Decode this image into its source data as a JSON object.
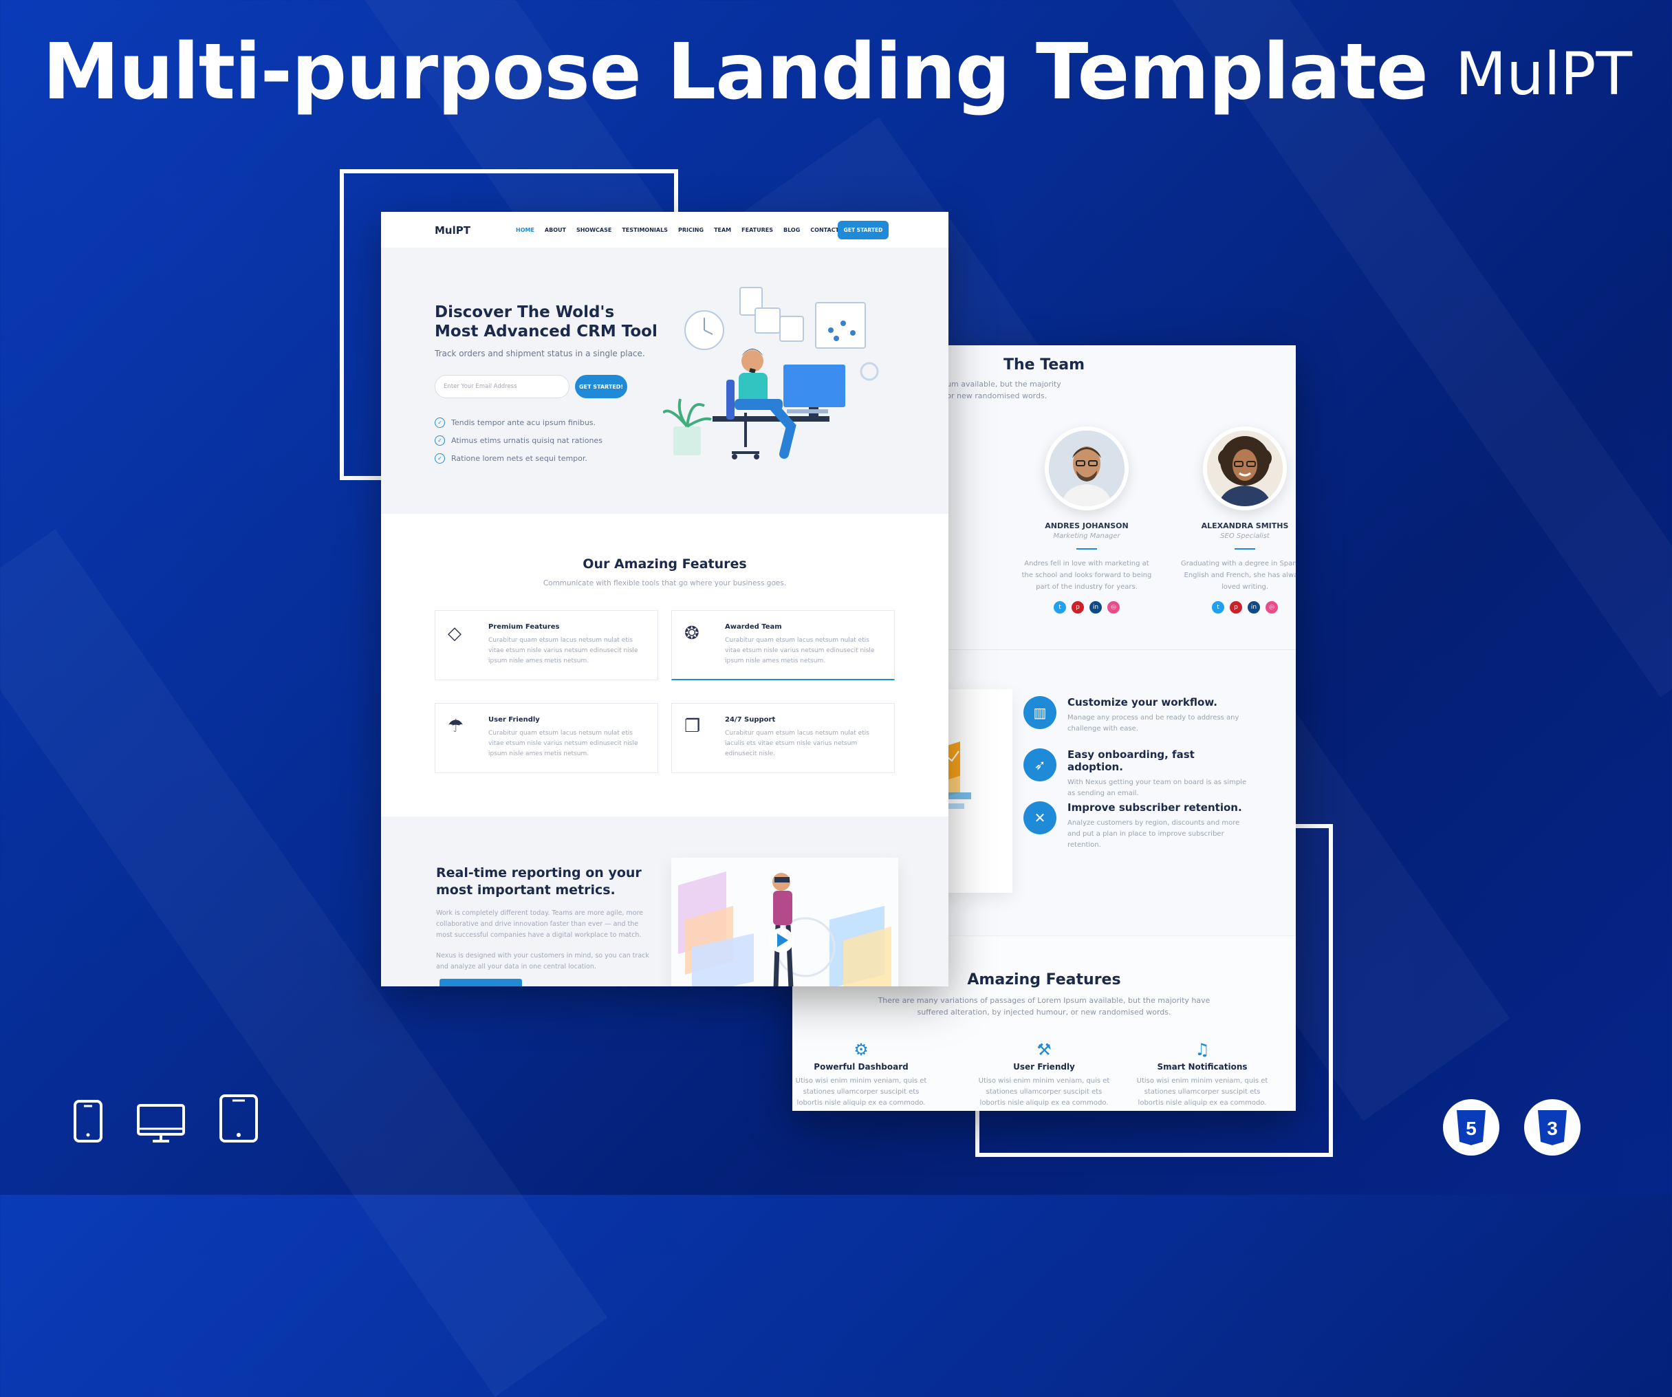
{
  "page": {
    "headline": "Multi-purpose Landing Template",
    "brand": "MulPT"
  },
  "front": {
    "nav": {
      "logo": "MulPT",
      "links": [
        "HOME",
        "ABOUT",
        "SHOWCASE",
        "TESTIMONIALS",
        "PRICING",
        "TEAM",
        "FEATURES",
        "BLOG",
        "CONTACT"
      ],
      "cta": "GET STARTED"
    },
    "hero": {
      "title": "Discover The Wold's Most Advanced CRM Tool",
      "subtitle": "Track orders and shipment status in a single place.",
      "email_placeholder": "Enter Your Email Address",
      "button": "GET STARTED!",
      "checks": [
        "Tendis tempor ante acu ipsum finibus.",
        "Atimus etims urnatis quisiq nat rationes",
        "Ratione lorem nets et sequi tempor."
      ]
    },
    "features": {
      "title": "Our Amazing Features",
      "subtitle": "Communicate with flexible tools that go where your business goes.",
      "cards": [
        {
          "title": "Premium Features",
          "text": "Curabitur quam etsum lacus netsum nulat etis vitae etsum nisle varius netsum edinusecit nisle ipsum nisle ames metis netsum.",
          "icon": "diamond-icon"
        },
        {
          "title": "Awarded Team",
          "text": "Curabitur quam etsum lacus netsum nulat etis vitae etsum nisle varius netsum edinusecit nisle ipsum nisle ames metis netsum.",
          "icon": "medal-icon"
        },
        {
          "title": "User Friendly",
          "text": "Curabitur quam etsum lacus netsum nulat etis vitae etsum nisle varius netsum edinusecit nisle ipsum nisle ames metis netsum.",
          "icon": "umbrella-icon"
        },
        {
          "title": "24/7 Support",
          "text": "Curabitur quam etsum lacus netsum nulat etis iaculis ets vitae etsum nisle varius netsum edinusecit nisle.",
          "icon": "chat-bubbles-icon"
        }
      ]
    },
    "report": {
      "title": "Real-time reporting on your most important metrics.",
      "p1": "Work is completely different today. Teams are more agile, more collaborative and drive innovation faster than ever — and the most successful companies have a digital workplace to match.",
      "p2": "Nexus is designed with your customers in mind, so you can track and analyze all your data in one central location."
    }
  },
  "back": {
    "team": {
      "title": "The Team",
      "subtitle": "variations of passages of Lorem Ipsum available, but the majority alteration, by injected humour, or new randomised words.",
      "members": [
        {
          "name": "ANDRES JOHANSON",
          "role": "Marketing Manager",
          "bio": "Andres fell in love with marketing at the school and looks forward to being part of the industry for years."
        },
        {
          "name": "ALEXANDRA SMITHS",
          "role": "SEO Specialist",
          "bio": "Graduating with a degree in Spanish, English and French, she has always loved writing."
        }
      ]
    },
    "workflow": [
      {
        "title": "Customize your workflow.",
        "text": "Manage any process and be ready to address any challenge with ease.",
        "icon": "map-icon"
      },
      {
        "title": "Easy onboarding, fast adoption.",
        "text": "With Nexus getting your team on board is as simple as sending an email.",
        "icon": "rocket-icon"
      },
      {
        "title": "Improve subscriber retention.",
        "text": "Analyze customers by region, discounts and more and put a plan in place to improve subscriber retention.",
        "icon": "tools-icon"
      }
    ],
    "amazing": {
      "title": "Amazing Features",
      "subtitle": "There are many variations of passages of Lorem Ipsum available, but the majority have suffered alteration, by injected humour, or new randomised words.",
      "items": [
        {
          "title": "Powerful Dashboard",
          "text": "Utiso wisi enim minim veniam, quis et stationes ullamcorper suscipit ets lobortis nisle aliquip ex ea commodo.",
          "icon": "gear-icon"
        },
        {
          "title": "User Friendly",
          "text": "Utiso wisi enim minim veniam, quis et stationes ullamcorper suscipit ets lobortis nisle aliquip ex ea commodo.",
          "icon": "wrench-icon"
        },
        {
          "title": "Smart Notifications",
          "text": "Utiso wisi enim minim veniam, quis et stationes ullamcorper suscipit ets lobortis nisle aliquip ex ea commodo.",
          "icon": "bell-icon"
        }
      ]
    }
  },
  "footer": {
    "devices": [
      "phone-icon",
      "desktop-icon",
      "tablet-icon"
    ],
    "tech": [
      "html5-icon",
      "css3-icon"
    ]
  }
}
